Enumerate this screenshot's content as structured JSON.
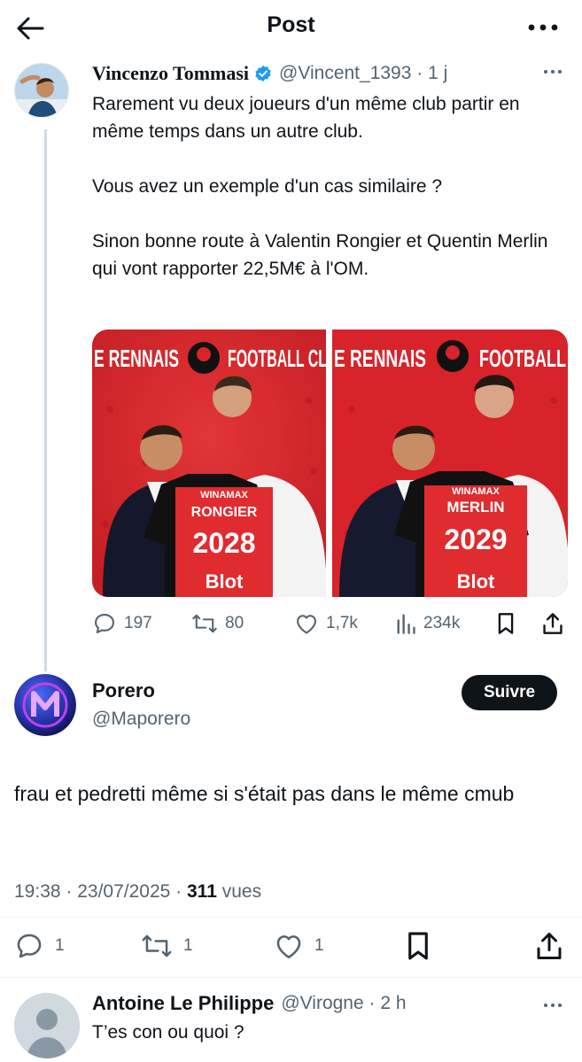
{
  "header": {
    "title": "Post"
  },
  "parent_tweet": {
    "author_name": "Vincenzo Tommasi",
    "handle": "@Vincent_1393",
    "time": "1 j",
    "text": "Rarement vu deux joueurs d'un même club partir en même temps dans un autre club.\n\nVous avez un exemple d'un cas similaire ?\n\nSinon bonne route à Valentin Rongier et Quentin Merlin qui vont rapporter 22,5M€ à l'OM.",
    "photos": [
      {
        "banner_left": "E RENNAIS",
        "banner_right": "FOOTBALL CL",
        "shirt_sponsor": "WINAMAX",
        "shirt_name": "RONGIER",
        "shirt_year": "2028",
        "shirt_brand": "Blot"
      },
      {
        "banner_left": "E RENNAIS",
        "banner_right": "FOOTBALL",
        "shirt_sponsor": "WINAMAX",
        "shirt_name": "MERLIN",
        "shirt_year": "2029",
        "shirt_brand": "Blot"
      }
    ],
    "stats": {
      "replies": "197",
      "reposts": "80",
      "likes": "1,7k",
      "views": "234k"
    }
  },
  "reply": {
    "author_name": "Porero",
    "handle": "@Maporero",
    "follow_label": "Suivre",
    "text": "frau et pedretti même si s'était pas dans le même cmub",
    "datetime": "19:38 · 23/07/2025 ·",
    "views_count": "311",
    "views_label": "vues",
    "stats": {
      "replies": "1",
      "reposts": "1",
      "likes": "1"
    }
  },
  "next_reply": {
    "author_name": "Antoine Le Philippe",
    "handle": "@Virogne",
    "time": "2 h",
    "text": "T’es con ou quoi ?"
  },
  "colors": {
    "accent": "#1d9bf0",
    "rennes_red": "#d8232a",
    "muted": "#536471"
  }
}
